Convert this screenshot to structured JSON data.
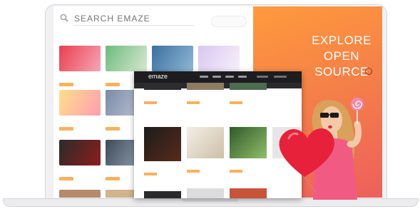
{
  "search": {
    "placeholder": "SEARCH EMAZE",
    "button_label": ""
  },
  "hero": {
    "title": "EXPLORE OPEN SOURCE",
    "accent": "#f47e49"
  },
  "app": {
    "logo": "emaze"
  },
  "colors": {
    "orange_start": "#ff9a3c",
    "orange_end": "#ee5f5c",
    "app_bar": "#1d1d1f",
    "button": "#f7b25e"
  }
}
